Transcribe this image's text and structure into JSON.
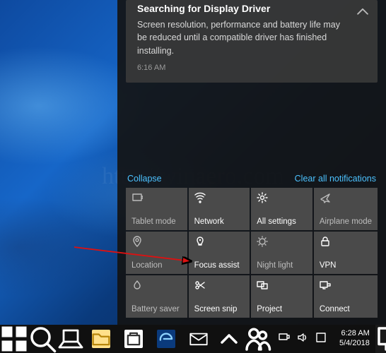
{
  "watermark_text": "http://winaero.com",
  "notification": {
    "title": "Searching for Display Driver",
    "body": "Screen resolution, performance and battery life may be reduced until a compatible driver has finished installing.",
    "time": "6:16 AM"
  },
  "action_center": {
    "collapse_label": "Collapse",
    "clear_label": "Clear all notifications",
    "tiles": [
      {
        "label": "Tablet mode",
        "icon": "tablet-mode-icon",
        "dimmed": true
      },
      {
        "label": "Network",
        "icon": "network-icon",
        "dimmed": false
      },
      {
        "label": "All settings",
        "icon": "settings-icon",
        "dimmed": false
      },
      {
        "label": "Airplane mode",
        "icon": "airplane-icon",
        "dimmed": true
      },
      {
        "label": "Location",
        "icon": "location-icon",
        "dimmed": true
      },
      {
        "label": "Focus assist",
        "icon": "focus-assist-icon",
        "dimmed": false
      },
      {
        "label": "Night light",
        "icon": "night-light-icon",
        "dimmed": true
      },
      {
        "label": "VPN",
        "icon": "vpn-icon",
        "dimmed": false
      },
      {
        "label": "Battery saver",
        "icon": "battery-saver-icon",
        "dimmed": true
      },
      {
        "label": "Screen snip",
        "icon": "screen-snip-icon",
        "dimmed": false
      },
      {
        "label": "Project",
        "icon": "project-icon",
        "dimmed": false
      },
      {
        "label": "Connect",
        "icon": "connect-icon",
        "dimmed": false
      }
    ]
  },
  "taskbar": {
    "time": "6:28 AM",
    "date": "5/4/2018"
  }
}
